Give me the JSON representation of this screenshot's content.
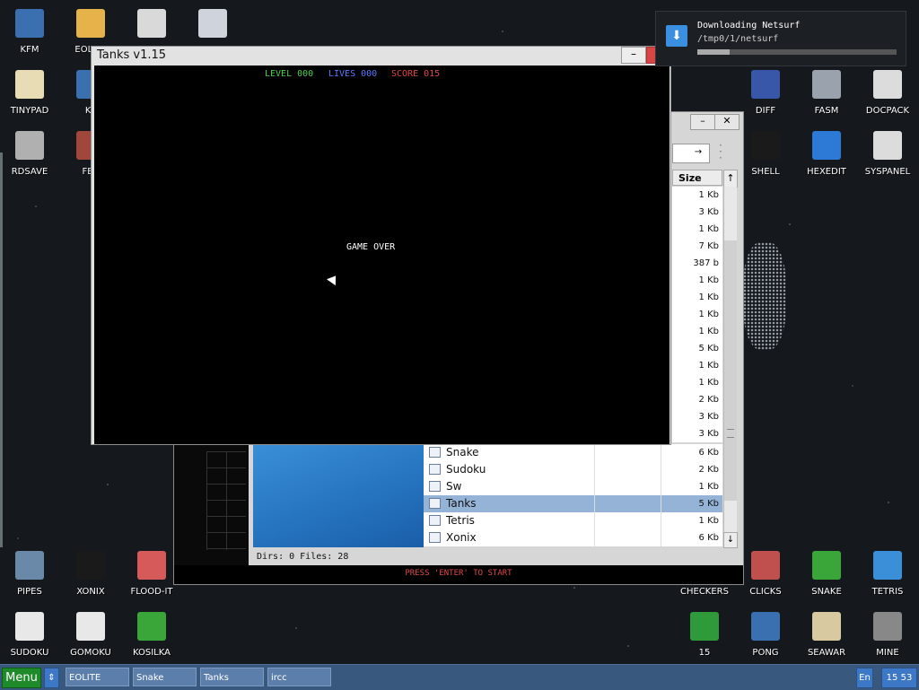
{
  "desktop_icons_left": [
    {
      "label": "KFM",
      "icon": "floppy-disk-icon",
      "color": "#3a6fb0"
    },
    {
      "label": "EOLITE",
      "icon": "folder-icon",
      "color": "#e6b24a"
    },
    {
      "label": "",
      "icon": "book-icon",
      "color": "#d9d9d9"
    },
    {
      "label": "",
      "icon": "calculator-icon",
      "color": "#cfd4dc"
    },
    {
      "label": "TINYPAD",
      "icon": "notepad-icon",
      "color": "#e8dcb5"
    },
    {
      "label": "KF",
      "icon": "kf-icon",
      "color": "#3a6fb0"
    },
    {
      "label": "RDSAVE",
      "icon": "rdsave-icon",
      "color": "#b0b0b0"
    },
    {
      "label": "FB2",
      "icon": "fb2-reader-icon",
      "color": "#a0463a"
    }
  ],
  "desktop_icons_right": [
    {
      "label": "DIFF",
      "icon": "diff-icon",
      "color": "#3857a8"
    },
    {
      "label": "FASM",
      "icon": "fasm-icon",
      "color": "#9aa3ad"
    },
    {
      "label": "DOCPACK",
      "icon": "docpack-icon",
      "color": "#dcdcdc"
    },
    {
      "label": "SHELL",
      "icon": "terminal-icon",
      "color": "#1a1a1a"
    },
    {
      "label": "HEXEDIT",
      "icon": "hexedit-icon",
      "color": "#2d7ad6"
    },
    {
      "label": "SYSPANEL",
      "icon": "syspanel-icon",
      "color": "#dcdcdc"
    }
  ],
  "desktop_icons_bottom_left": [
    {
      "label": "PIPES",
      "icon": "pipes-icon",
      "color": "#6a88a8"
    },
    {
      "label": "XONIX",
      "icon": "xonix-icon",
      "color": "#1a1a1a"
    },
    {
      "label": "FLOOD-IT",
      "icon": "flood-it-icon",
      "color": "#d65a5a"
    },
    {
      "label": "SUDOKU",
      "icon": "sudoku-icon",
      "color": "#e8e8e8"
    },
    {
      "label": "GOMOKU",
      "icon": "gomoku-icon",
      "color": "#e8e8e8"
    },
    {
      "label": "KOSILKA",
      "icon": "lawnmower-icon",
      "color": "#3aa63a"
    }
  ],
  "desktop_icons_bottom_right": [
    {
      "label": "CHECKERS",
      "icon": "checkers-icon",
      "color": "#2a2a2a"
    },
    {
      "label": "CLICKS",
      "icon": "clicks-icon",
      "color": "#c0504d"
    },
    {
      "label": "SNAKE",
      "icon": "snake-icon",
      "color": "#3aa63a"
    },
    {
      "label": "TETRIS",
      "icon": "tetris-icon",
      "color": "#3a8fd8"
    },
    {
      "label": "15",
      "icon": "fifteen-puzzle-icon",
      "color": "#2f9a3a"
    },
    {
      "label": "PONG",
      "icon": "pong-icon",
      "color": "#3a6fb0"
    },
    {
      "label": "SEAWAR",
      "icon": "seawar-icon",
      "color": "#d8c9a0"
    },
    {
      "label": "MINE",
      "icon": "mine-icon",
      "color": "#888888"
    }
  ],
  "tanks_window": {
    "title": "Tanks v1.15",
    "level_label": "LEVEL 000",
    "lives_label": "LIVES 000",
    "score_label": "SCORE 015",
    "game_over": "GAME OVER",
    "colors": {
      "level": "#4ccf4c",
      "lives": "#5a78ff",
      "score": "#e04a4a"
    }
  },
  "file_manager": {
    "size_header": "Size",
    "sort_arrow": "↑",
    "go_arrow": "→",
    "sizes_above": [
      "1 Kb",
      "3 Kb",
      "1 Kb",
      "7 Kb",
      "387 b",
      "1 Kb",
      "1 Kb",
      "1 Kb",
      "1 Kb",
      "5 Kb",
      "1 Kb",
      "1 Kb",
      "2 Kb",
      "3 Kb",
      "3 Kb"
    ],
    "files": [
      {
        "name": "Snake",
        "size": "6 Kb",
        "selected": false
      },
      {
        "name": "Sudoku",
        "size": "2 Kb",
        "selected": false
      },
      {
        "name": "Sw",
        "size": "1 Kb",
        "selected": false
      },
      {
        "name": "Tanks",
        "size": "5 Kb",
        "selected": true
      },
      {
        "name": "Tetris",
        "size": "1 Kb",
        "selected": false
      },
      {
        "name": "Xonix",
        "size": "6 Kb",
        "selected": false
      }
    ],
    "status": "Dirs: 0   Files: 28",
    "press_enter": "PRESS 'ENTER' TO START"
  },
  "notification": {
    "title": "Downloading Netsurf",
    "path": "/tmp0/1/netsurf",
    "progress": 0.16
  },
  "taskbar": {
    "menu_label": "Menu",
    "switch_label": "⇕",
    "tasks": [
      "EOLITE",
      "Snake",
      "Tanks",
      "ircc"
    ],
    "lang": "En",
    "clock": "15 53"
  }
}
